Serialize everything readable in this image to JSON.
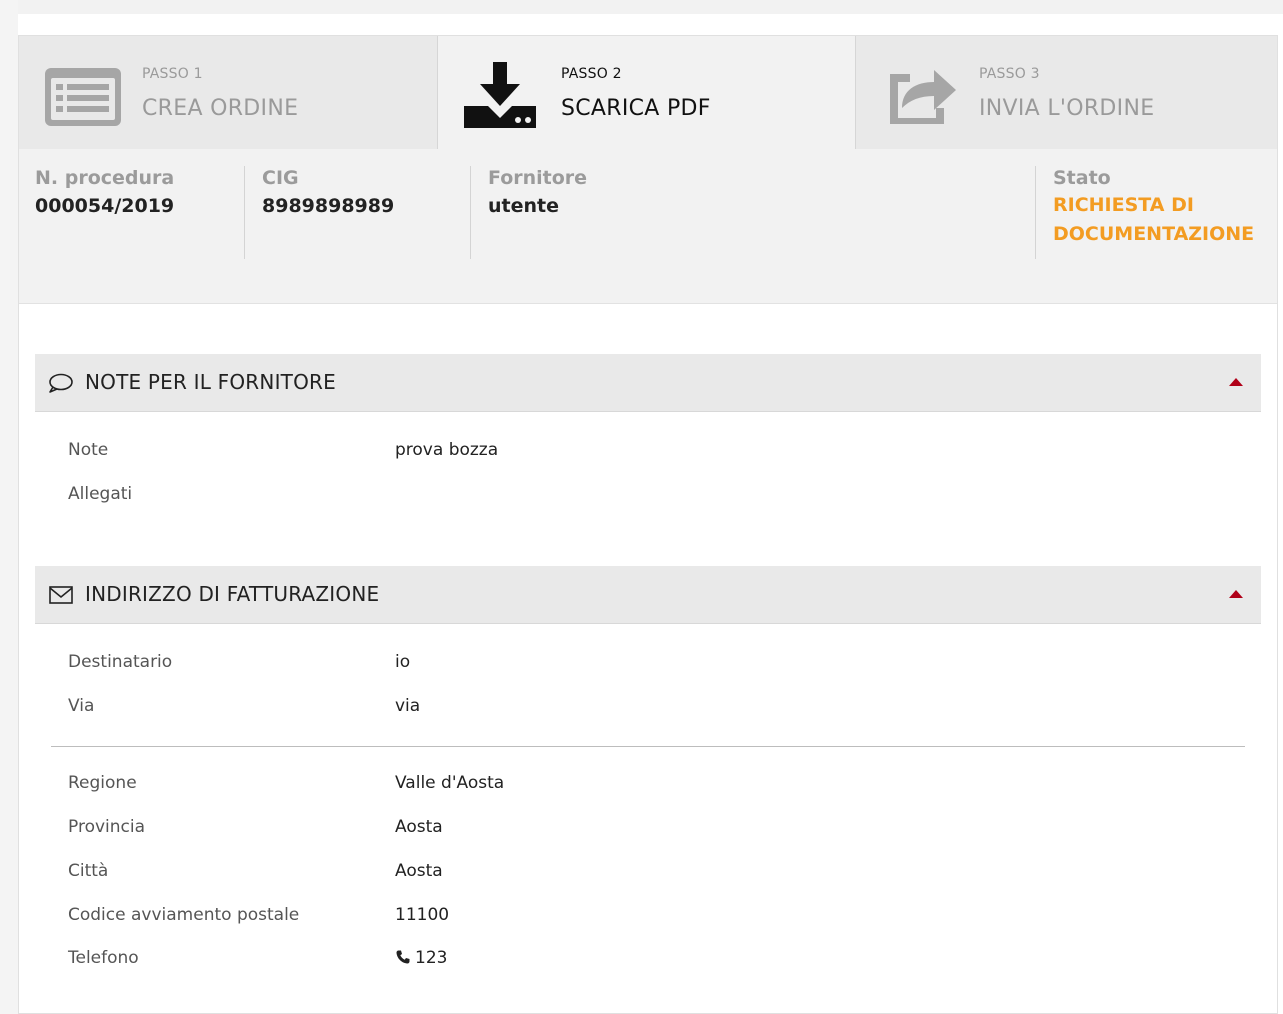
{
  "steps": [
    {
      "pass": "PASSO 1",
      "label": "CREA ORDINE",
      "icon": "list-icon",
      "state": "inactive"
    },
    {
      "pass": "PASSO 2",
      "label": "SCARICA PDF",
      "icon": "download-icon",
      "state": "active"
    },
    {
      "pass": "PASSO 3",
      "label": "INVIA L'ORDINE",
      "icon": "share-icon",
      "state": "inactive"
    }
  ],
  "info": {
    "procedura": {
      "label": "N. procedura",
      "value": "000054/2019"
    },
    "cig": {
      "label": "CIG",
      "value": "8989898989"
    },
    "fornitore": {
      "label": "Fornitore",
      "value": "utente"
    },
    "stato": {
      "label": "Stato",
      "value_line1": "RICHIESTA DI",
      "value_line2": "DOCUMENTAZIONE"
    }
  },
  "colors": {
    "accent_orange": "#f39c22",
    "caret_red": "#b00018"
  },
  "note_section": {
    "title": "NOTE PER IL FORNITORE",
    "icon": "comment-icon",
    "rows": [
      {
        "label": "Note",
        "value": "prova bozza"
      },
      {
        "label": "Allegati",
        "value": ""
      }
    ]
  },
  "billing_section": {
    "title": "INDIRIZZO DI FATTURAZIONE",
    "icon": "envelope-icon",
    "rows_top": [
      {
        "label": "Destinatario",
        "value": "io"
      },
      {
        "label": "Via",
        "value": "via"
      }
    ],
    "rows_bottom": [
      {
        "label": "Regione",
        "value": "Valle d'Aosta"
      },
      {
        "label": "Provincia",
        "value": "Aosta"
      },
      {
        "label": "Città",
        "value": "Aosta"
      },
      {
        "label": "Codice avviamento postale",
        "value": "11100"
      },
      {
        "label": "Telefono",
        "value": "123",
        "icon": "phone-icon"
      }
    ]
  }
}
